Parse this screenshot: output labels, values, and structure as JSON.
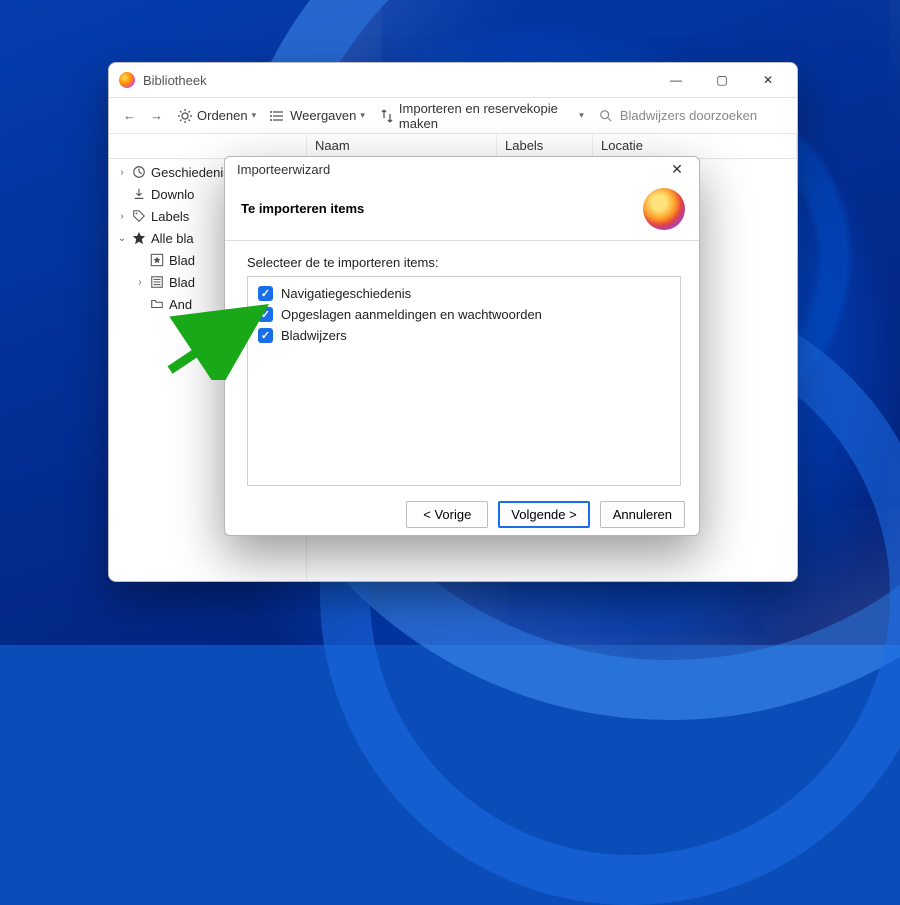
{
  "library": {
    "title": "Bibliotheek",
    "toolbar": {
      "back": "←",
      "forward": "→",
      "organize": "Ordenen",
      "views": "Weergaven",
      "import": "Importeren en reservekopie maken",
      "search_placeholder": "Bladwijzers doorzoeken"
    },
    "columns": {
      "name": "Naam",
      "labels": "Labels",
      "location": "Locatie"
    },
    "tree": [
      {
        "label": "Geschiedenis",
        "icon": "history",
        "caret": ">",
        "depth": 0
      },
      {
        "label": "Downlo",
        "icon": "download",
        "caret": "",
        "depth": 0
      },
      {
        "label": "Labels",
        "icon": "tag",
        "caret": ">",
        "depth": 0
      },
      {
        "label": "Alle bla",
        "icon": "star-filled",
        "caret": "v",
        "depth": 0
      },
      {
        "label": "Blad",
        "icon": "star-box",
        "caret": "",
        "depth": 1
      },
      {
        "label": "Blad",
        "icon": "list",
        "caret": ">",
        "depth": 1
      },
      {
        "label": "And",
        "icon": "folder",
        "caret": "",
        "depth": 1
      }
    ]
  },
  "wizard": {
    "window_title": "Importeerwizard",
    "heading": "Te importeren items",
    "prompt": "Selecteer de te importeren items:",
    "items": [
      {
        "label": "Navigatiegeschiedenis",
        "checked": true
      },
      {
        "label": "Opgeslagen aanmeldingen en wachtwoorden",
        "checked": true
      },
      {
        "label": "Bladwijzers",
        "checked": true
      }
    ],
    "buttons": {
      "back": "< Vorige",
      "next": "Volgende >",
      "cancel": "Annuleren"
    }
  }
}
